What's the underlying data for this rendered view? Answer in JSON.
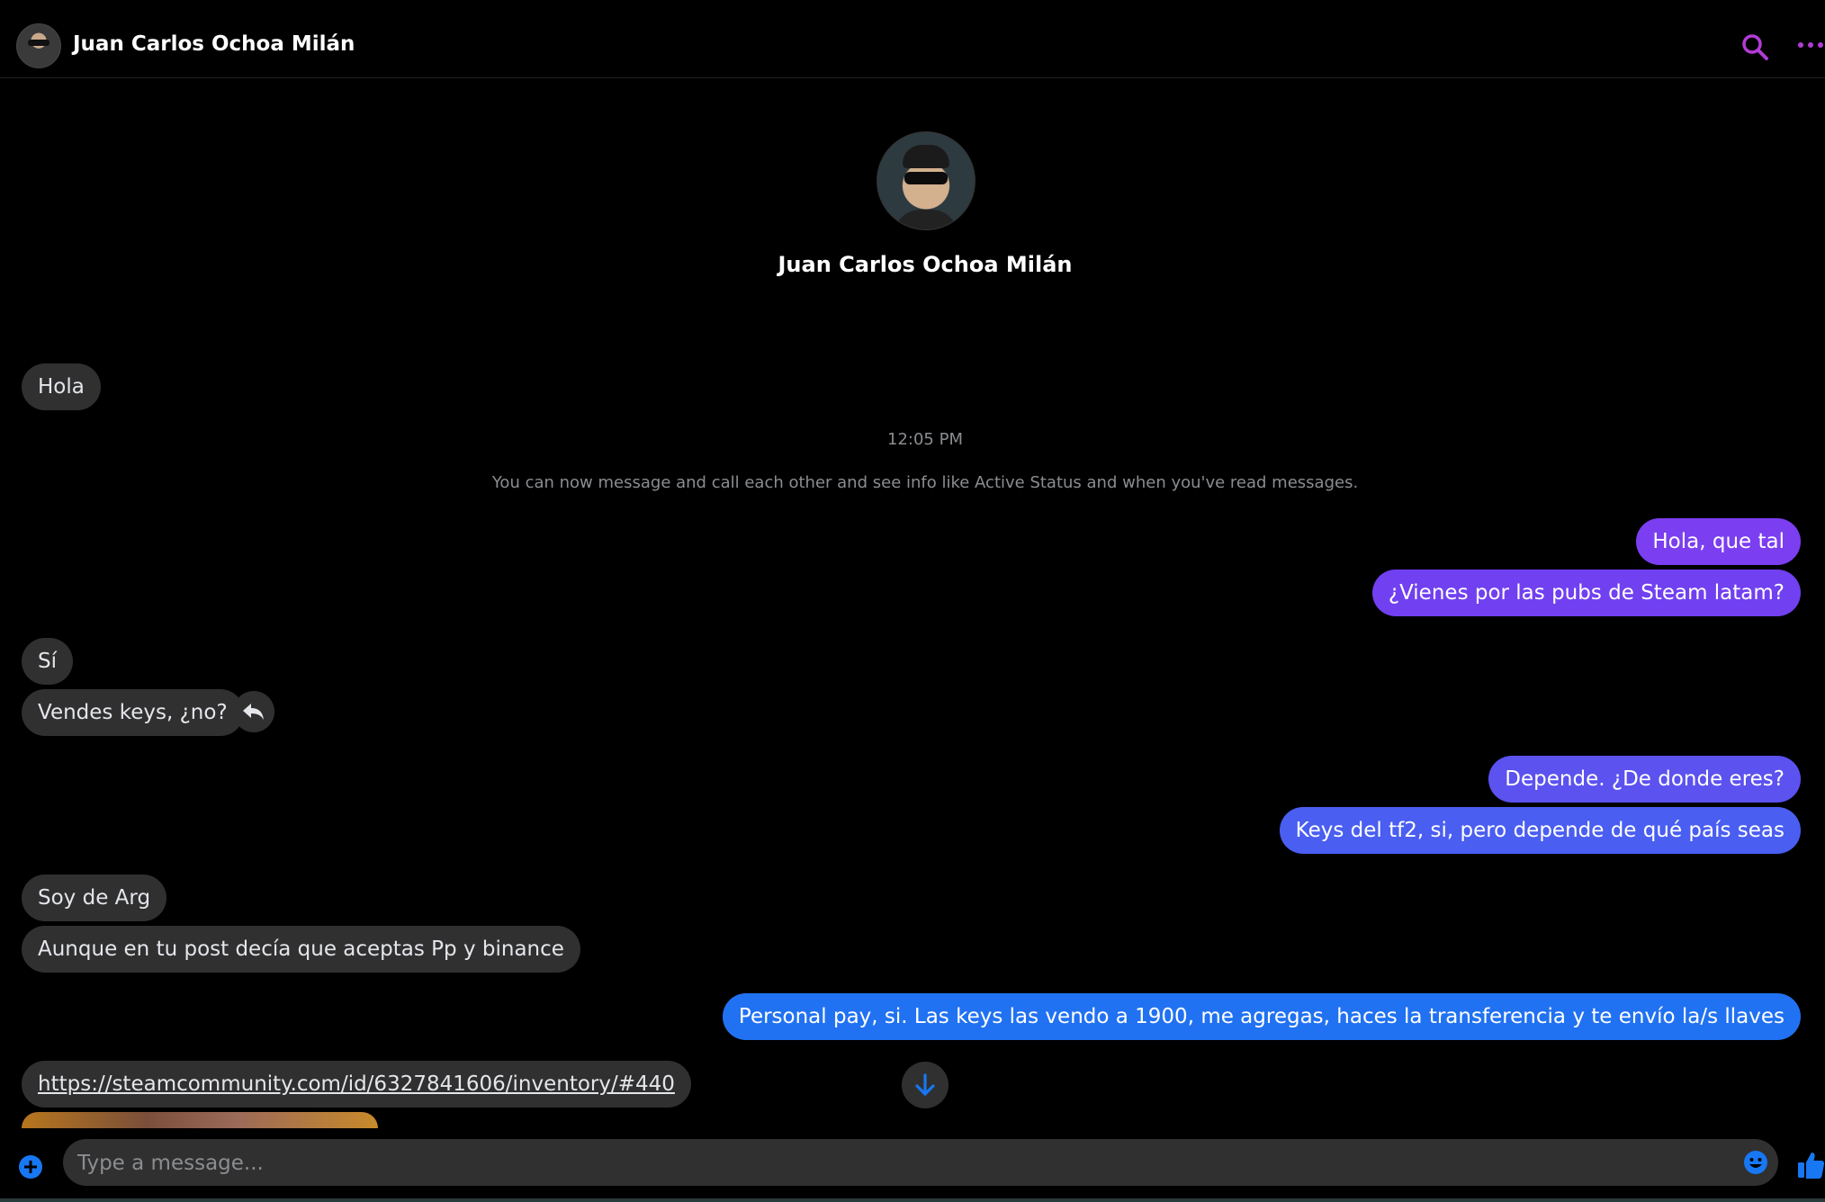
{
  "header": {
    "contact_name": "Juan Carlos Ochoa Milán",
    "icons": [
      "search-icon",
      "more-options-icon"
    ],
    "accent_color": "#b33bd6"
  },
  "profile": {
    "name": "Juan Carlos Ochoa Milán"
  },
  "conversation": {
    "timestamp": "12:05 PM",
    "system_notice": "You can now message and call each other and see info like Active Status and when you've read messages.",
    "messages": [
      {
        "from": "them",
        "text": "Hola"
      },
      {
        "from": "me",
        "text": "Hola, que tal"
      },
      {
        "from": "me",
        "text": "¿Vienes por las pubs de Steam latam?"
      },
      {
        "from": "them",
        "text": "Sí"
      },
      {
        "from": "them",
        "text": "Vendes keys, ¿no?"
      },
      {
        "from": "me",
        "text": "Depende. ¿De donde eres?"
      },
      {
        "from": "me",
        "text": "Keys del tf2, si, pero depende de qué país seas"
      },
      {
        "from": "them",
        "text": "Soy de Arg"
      },
      {
        "from": "them",
        "text": "Aunque en tu post decía que aceptas Pp y binance"
      },
      {
        "from": "me",
        "text": "Personal pay, si. Las keys las vendo a 1900, me agregas, haces la transferencia y te envío la/s llaves"
      },
      {
        "from": "them",
        "text": "https://steamcommunity.com/id/6327841606/inventory/#440"
      }
    ],
    "outgoing_gradient_colors": [
      "#7a3ff0",
      "#4f5ef0",
      "#1f78f2"
    ],
    "incoming_color": "#303030"
  },
  "composer": {
    "placeholder": "Type a message...",
    "icons": [
      "plus-icon",
      "emoji-icon",
      "thumbs-up-icon"
    ],
    "icon_color": "#1877f2"
  }
}
